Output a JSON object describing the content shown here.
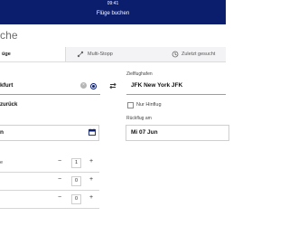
{
  "status_bar": {
    "time": "09:41"
  },
  "header": {
    "title": "Flüge buchen"
  },
  "page": {
    "title": "che"
  },
  "tabs": [
    {
      "label": "üge",
      "icon": "plane-icon"
    },
    {
      "label": "Multi-Stopp",
      "icon": "multi-stop-icon"
    },
    {
      "label": "Zuletzt gesucht",
      "icon": "history-icon"
    }
  ],
  "origin": {
    "value": "kfurt"
  },
  "destination": {
    "label": "Zielflughafen",
    "value": "JFK New York JFK"
  },
  "return_flight": {
    "label": "zurück"
  },
  "oneway": {
    "label": "Nur Hinflug"
  },
  "departure_date": {
    "value": "n"
  },
  "return_date": {
    "label": "Rückflug am",
    "value": "Mi 07 Jun"
  },
  "passengers": [
    {
      "label": "e",
      "count": "1"
    },
    {
      "label": "",
      "count": "0"
    },
    {
      "label": "",
      "count": "0"
    }
  ],
  "stepper": {
    "minus": "−",
    "plus": "+"
  },
  "colors": {
    "header_bg": "#0b1e6d",
    "accent": "#0b1e6d"
  }
}
